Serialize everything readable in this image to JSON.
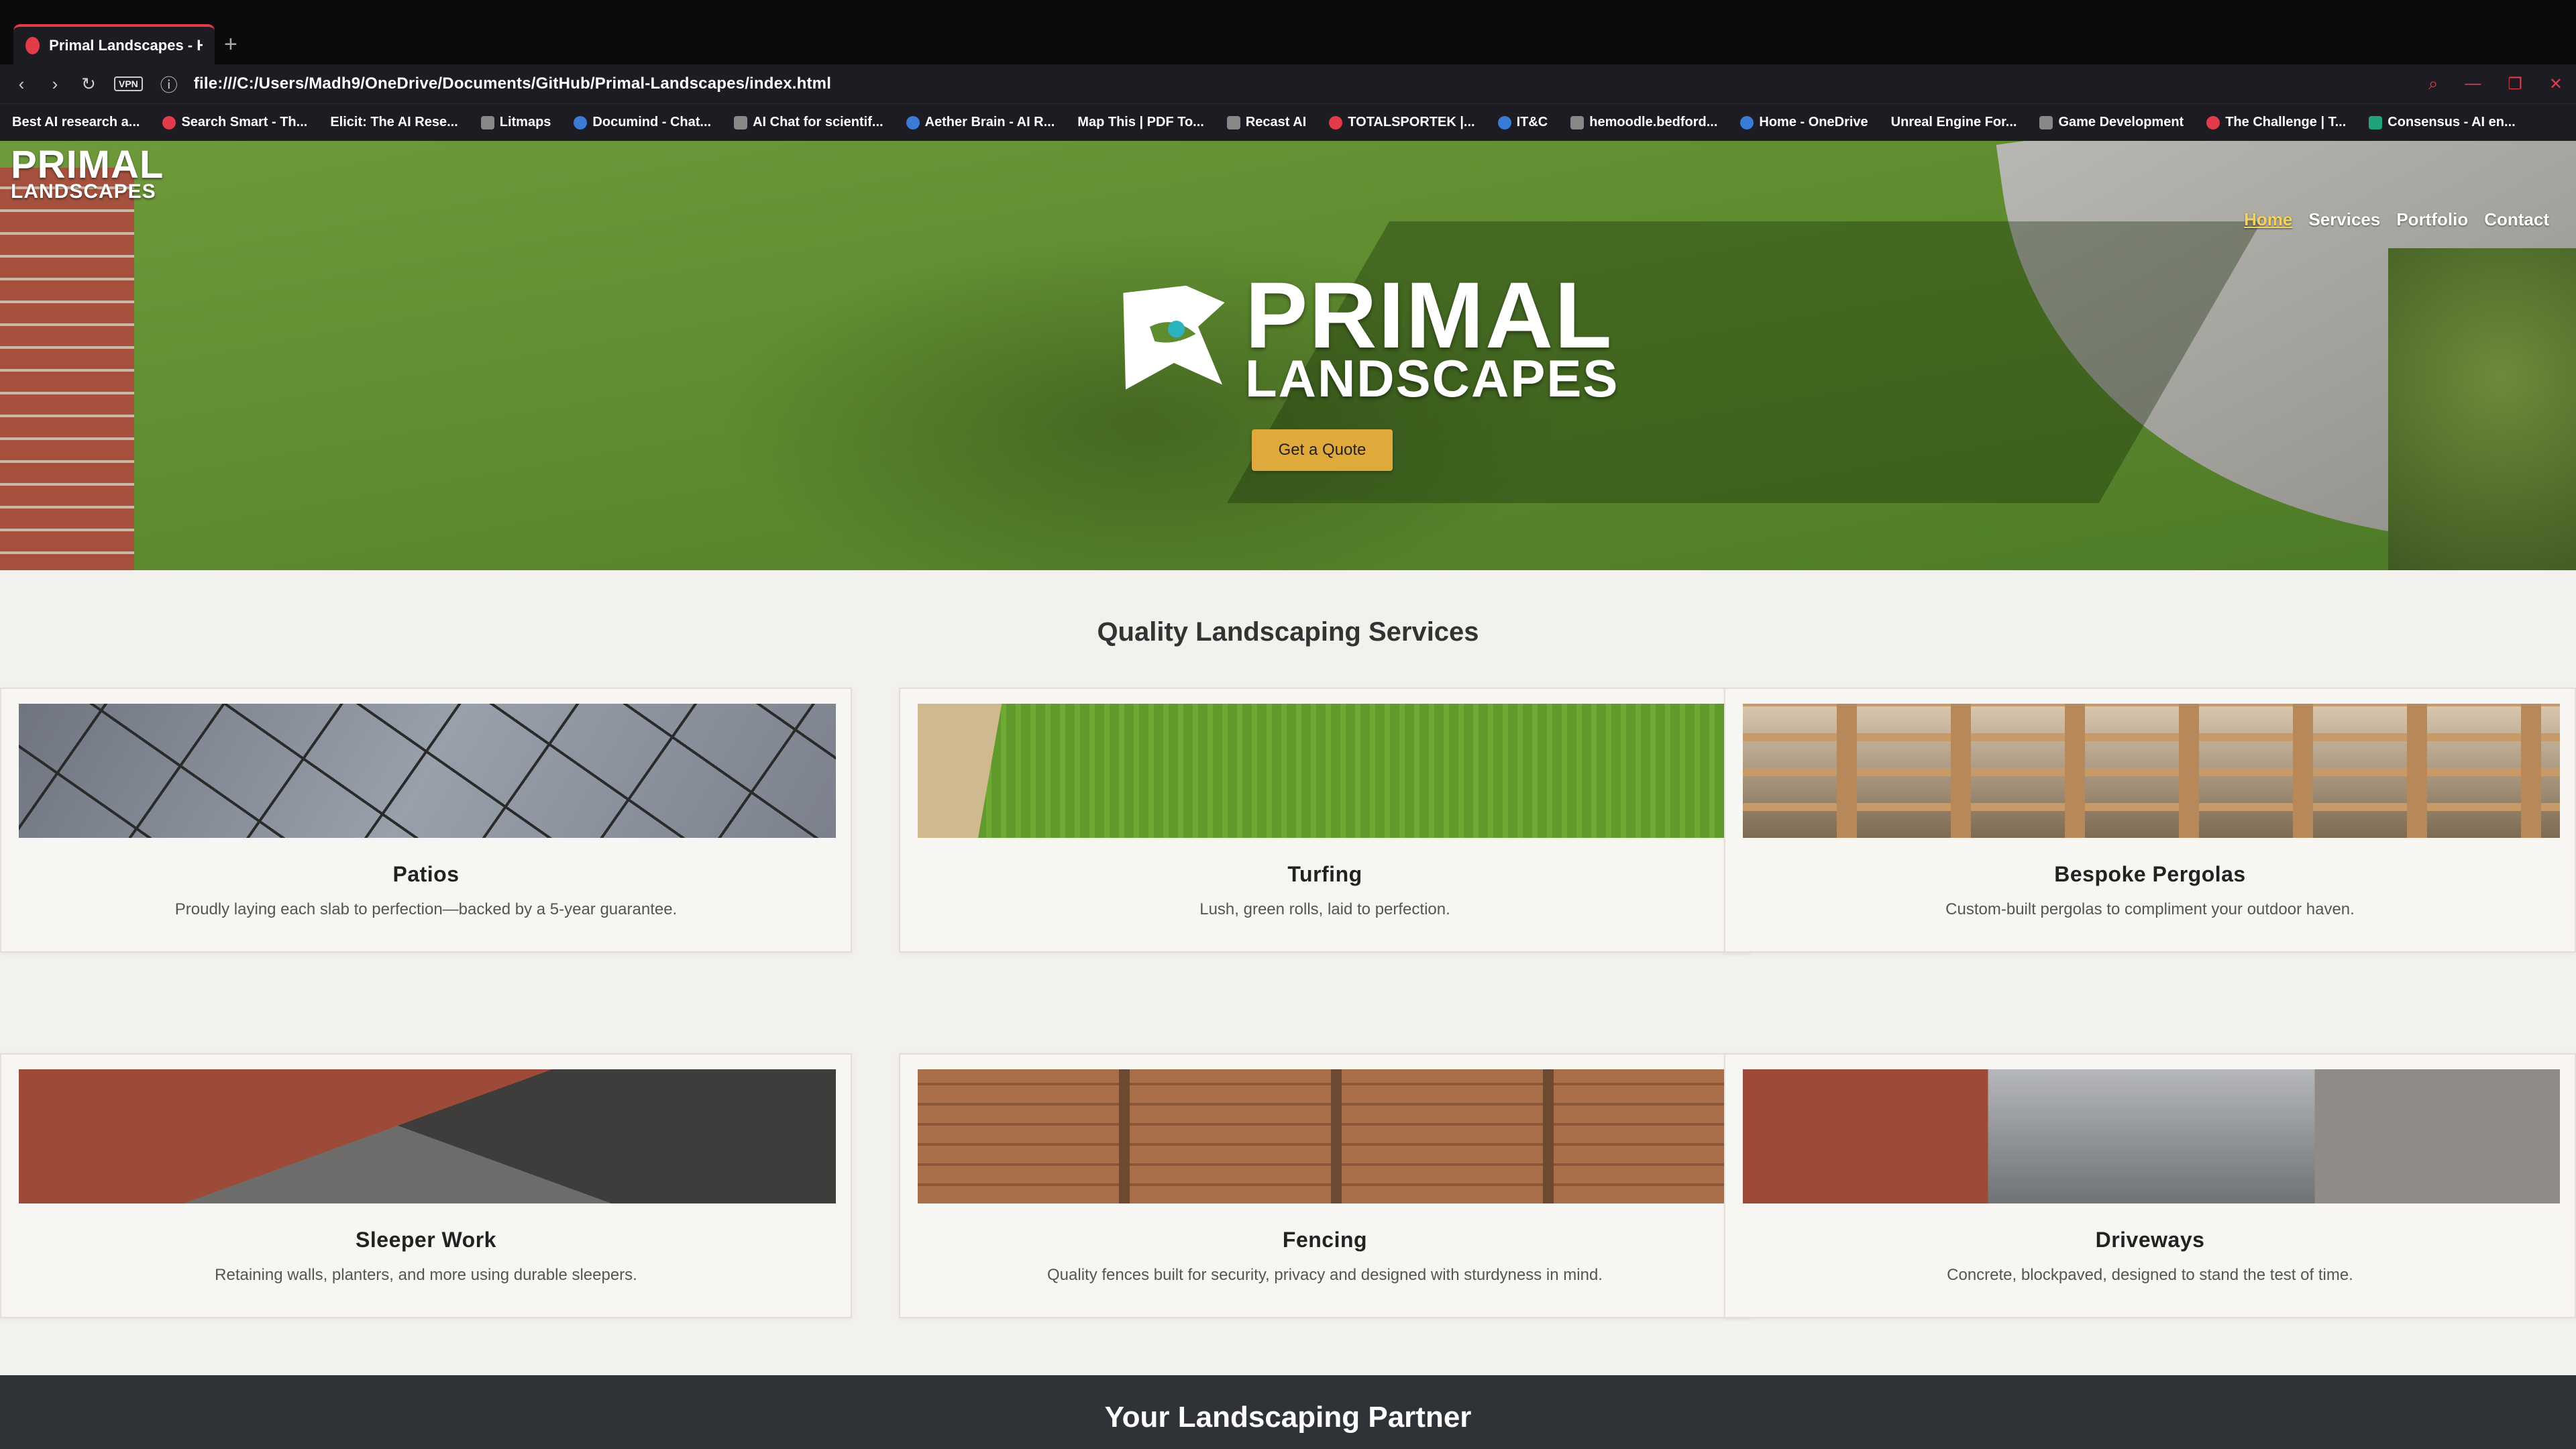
{
  "browser": {
    "tab_title": "Primal Landscapes - Home",
    "new_tab": "+",
    "vpn_badge": "VPN",
    "url": "file:///C:/Users/Madh9/OneDrive/Documents/GitHub/Primal-Landscapes/index.html",
    "bookmarks": [
      "Best AI research a...",
      "Search Smart - Th...",
      "Elicit: The AI Rese...",
      "Litmaps",
      "Documind - Chat...",
      "AI Chat for scientif...",
      "Aether Brain - AI R...",
      "Map This | PDF To...",
      "Recast AI",
      "TOTALSPORTEK |...",
      "IT&C",
      "hemoodle.bedford...",
      "Home - OneDrive",
      "Unreal Engine For...",
      "Game Development",
      "The Challenge | T...",
      "Consensus - AI en..."
    ]
  },
  "site": {
    "logo": {
      "line1": "PRIMAL",
      "line2": "LANDSCAPES"
    },
    "nav": [
      {
        "label": "Home",
        "active": true
      },
      {
        "label": "Services",
        "active": false
      },
      {
        "label": "Portfolio",
        "active": false
      },
      {
        "label": "Contact",
        "active": false
      }
    ],
    "hero": {
      "logo_line1": "PRIMAL",
      "logo_line2": "LANDSCAPES",
      "cta": "Get a Quote"
    },
    "services_title": "Quality Landscaping Services",
    "services": [
      {
        "title": "Patios",
        "desc": "Proudly laying each slab to perfection—backed by a 5-year guarantee."
      },
      {
        "title": "Turfing",
        "desc": "Lush, green rolls, laid to perfection."
      },
      {
        "title": "Bespoke Pergolas",
        "desc": "Custom-built pergolas to compliment your outdoor haven."
      },
      {
        "title": "Sleeper Work",
        "desc": "Retaining walls, planters, and more using durable sleepers."
      },
      {
        "title": "Fencing",
        "desc": "Quality fences built for security, privacy and designed with sturdyness in mind."
      },
      {
        "title": "Driveways",
        "desc": "Concrete, blockpaved, designed to stand the test of time."
      }
    ],
    "partner_title": "Your Landscaping Partner"
  },
  "colors": {
    "accent": "#e0a93b",
    "nav_active": "#f3d35c",
    "browser_accent": "#e23b4a"
  }
}
